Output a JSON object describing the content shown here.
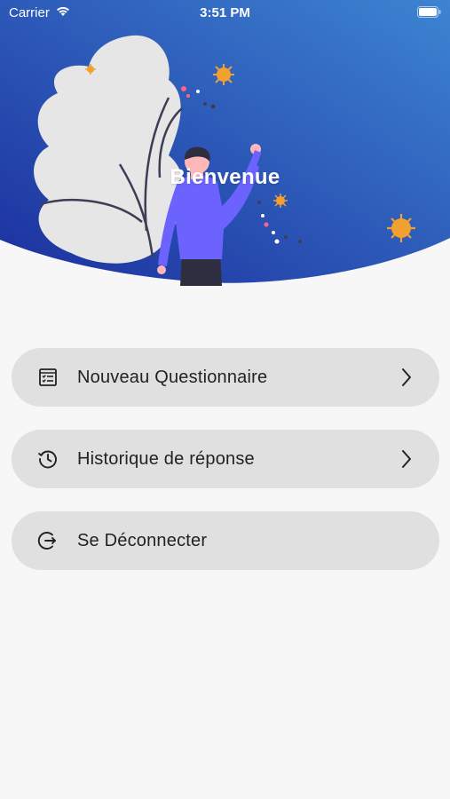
{
  "status_bar": {
    "carrier": "Carrier",
    "time": "3:51 PM"
  },
  "header": {
    "title": "Bienvenue",
    "gradient_start": "#1e3aa8",
    "gradient_end": "#3b7fd0"
  },
  "menu": {
    "items": [
      {
        "label": "Nouveau Questionnaire",
        "icon": "questionnaire-icon",
        "has_chevron": true
      },
      {
        "label": "Historique de réponse",
        "icon": "history-icon",
        "has_chevron": true
      },
      {
        "label": "Se Déconnecter",
        "icon": "logout-icon",
        "has_chevron": false
      }
    ]
  },
  "colors": {
    "background": "#f7f7f7",
    "menu_item_bg": "#e0e0e0",
    "accent_orange": "#f2a030",
    "figure_shirt": "#6c63ff"
  }
}
